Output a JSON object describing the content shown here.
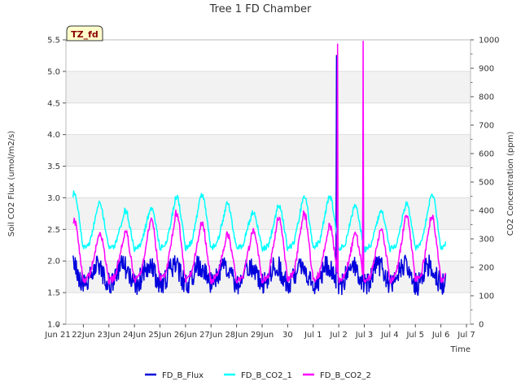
{
  "chart_data": {
    "type": "line",
    "title": "Tree 1 FD Chamber",
    "xlabel": "Time",
    "ylabel": "Soil CO2 Flux (umol/m2/s)",
    "y2label": "CO2 Concentration (ppm)",
    "badge": "TZ_fd",
    "x_tick_labels": [
      "Jun 21",
      "22Jun",
      "23Jun",
      "24Jun",
      "25Jun",
      "26Jun",
      "27Jun",
      "28Jun",
      "29Jun",
      "30",
      "Jul 1",
      "Jul 2",
      "Jul 3",
      "Jul 4",
      "Jul 5",
      "Jul 6",
      "Jul 7"
    ],
    "xlim_days": [
      0,
      16
    ],
    "ylim": [
      1.0,
      5.5
    ],
    "y_ticks": [
      "1.0",
      "1.5",
      "2.0",
      "2.5",
      "3.0",
      "3.5",
      "4.0",
      "4.5",
      "5.0",
      "5.5"
    ],
    "y2lim": [
      0,
      1000
    ],
    "y2_ticks": [
      "0",
      "100",
      "200",
      "300",
      "400",
      "500",
      "600",
      "700",
      "800",
      "900",
      "1000"
    ],
    "grid": true,
    "legend_position": "bottom",
    "series": [
      {
        "name": "FD_B_Flux",
        "axis": "left",
        "color": "#0000dd",
        "x_start": 0.6,
        "x_end": 15.2,
        "daily_pattern": {
          "mean": 1.78,
          "amplitude": 0.25,
          "noise": 0.18
        },
        "spikes": [
          {
            "x": 10.92,
            "value": 5.25
          },
          {
            "x": 11.95,
            "value": 4.05
          }
        ]
      },
      {
        "name": "FD_B_CO2_1",
        "axis": "right",
        "color": "#00ffff",
        "x_start": 0.6,
        "x_end": 15.2,
        "daily_pattern": {
          "low": 250,
          "high": 460,
          "noise": 10
        },
        "spikes": []
      },
      {
        "name": "FD_B_CO2_2",
        "axis": "right",
        "color": "#ff00ff",
        "x_start": 0.6,
        "x_end": 15.2,
        "daily_pattern": {
          "low": 135,
          "high": 390,
          "noise": 12
        },
        "spikes": [
          {
            "x": 10.95,
            "value": 985
          },
          {
            "x": 11.95,
            "value": 995
          }
        ]
      }
    ]
  }
}
